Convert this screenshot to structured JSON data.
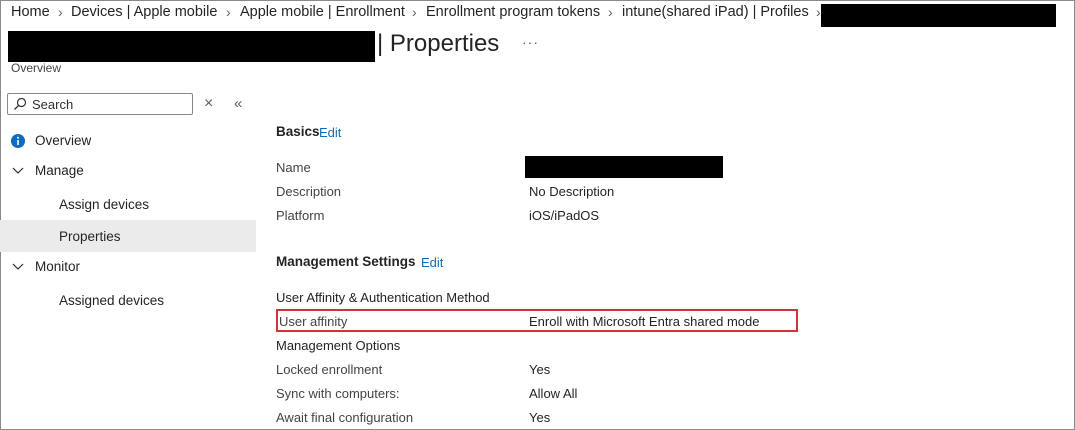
{
  "breadcrumb": {
    "items": [
      "Home",
      "Devices | Apple mobile",
      "Apple mobile | Enrollment",
      "Enrollment program tokens",
      "intune(shared iPad) | Profiles"
    ],
    "separator": "›"
  },
  "header": {
    "title": "| Properties",
    "ellipsis": "···",
    "subtitle": "Overview"
  },
  "search": {
    "placeholder": "Search",
    "close": "×",
    "collapse": "«"
  },
  "nav": {
    "overview": "Overview",
    "manage": "Manage",
    "assign_devices": "Assign devices",
    "properties": "Properties",
    "monitor": "Monitor",
    "assigned_devices": "Assigned devices"
  },
  "basics": {
    "title": "Basics",
    "edit": "Edit",
    "rows": [
      {
        "label": "Name",
        "value": ""
      },
      {
        "label": "Description",
        "value": "No Description"
      },
      {
        "label": "Platform",
        "value": "iOS/iPadOS"
      }
    ]
  },
  "management": {
    "title": "Management Settings",
    "edit": "Edit",
    "group1": "User Affinity & Authentication Method",
    "user_affinity": {
      "label": "User affinity",
      "value": "Enroll with Microsoft Entra shared mode"
    },
    "group2": "Management Options",
    "rows": [
      {
        "label": "Locked enrollment",
        "value": "Yes"
      },
      {
        "label": "Sync with computers:",
        "value": "Allow All"
      },
      {
        "label": "Await final configuration",
        "value": "Yes"
      }
    ]
  },
  "colors": {
    "accent": "#0f6cbd",
    "highlight": "#d13438",
    "selected_bg": "#ebebeb",
    "info": "#0f6cbd"
  }
}
